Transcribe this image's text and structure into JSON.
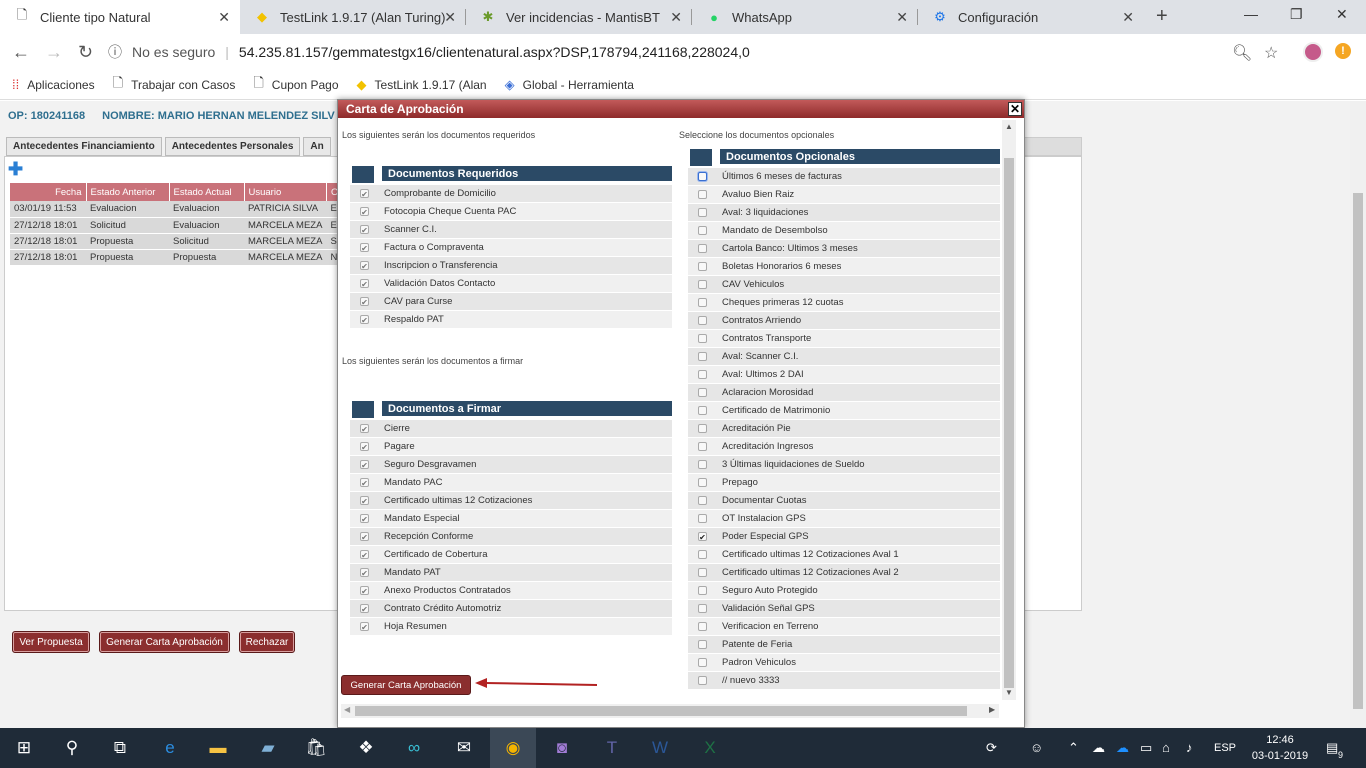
{
  "browser": {
    "tabs": [
      {
        "title": "Cliente tipo Natural",
        "icon": "page-icon"
      },
      {
        "title": "TestLink 1.9.17 (Alan Turing)",
        "icon": "testlink-icon"
      },
      {
        "title": "Ver incidencias - MantisBT",
        "icon": "mantis-icon"
      },
      {
        "title": "WhatsApp",
        "icon": "whatsapp-icon"
      },
      {
        "title": "Configuración",
        "icon": "gear-icon"
      }
    ],
    "security_label": "No es seguro",
    "url": "54.235.81.157/gemmatestgx16/clientenatural.aspx?DSP,178794,241168,228024,0",
    "bookmarks": [
      "Aplicaciones",
      "Trabajar con Casos",
      "Cupon Pago",
      "TestLink 1.9.17 (Alan",
      "Global - Herramienta"
    ]
  },
  "page": {
    "op_label": "OP: 180241168",
    "name_label": "NOMBRE: MARIO HERNAN MELENDEZ SILV",
    "tabs": [
      "Antecedentes Financiamiento",
      "Antecedentes Personales",
      "An"
    ],
    "history_headers": [
      "Fecha",
      "Estado Anterior",
      "Estado Actual",
      "Usuario",
      "O"
    ],
    "history_rows": [
      [
        "03/01/19 11:53",
        "Evaluacion",
        "Evaluacion",
        "PATRICIA SILVA",
        "Ev"
      ],
      [
        "27/12/18 18:01",
        "Solicitud",
        "Evaluacion",
        "MARCELA MEZA",
        "Ev"
      ],
      [
        "27/12/18 18:01",
        "Propuesta",
        "Solicitud",
        "MARCELA MEZA",
        "So"
      ],
      [
        "27/12/18 18:01",
        "Propuesta",
        "Propuesta",
        "MARCELA MEZA",
        "No"
      ]
    ],
    "buttons": {
      "ver_propuesta": "Ver Propuesta",
      "generar_carta": "Generar Carta Aprobación",
      "rechazar": "Rechazar"
    }
  },
  "modal": {
    "title": "Carta de Aprobación",
    "close": "✕",
    "note_required": "Los siguientes serán los documentos requeridos",
    "note_optional": "Seleccione los documentos opcionales",
    "note_sign": "Los siguientes serán los documentos a firmar",
    "required_header": "Documentos Requeridos",
    "required_docs": [
      "Comprobante de Domicilio",
      "Fotocopia Cheque Cuenta PAC",
      "Scanner C.I.",
      "Factura o Compraventa",
      "Inscripcion o Transferencia",
      "Validación Datos Contacto",
      "CAV para Curse",
      "Respaldo PAT"
    ],
    "sign_header": "Documentos a Firmar",
    "sign_docs": [
      "Cierre",
      "Pagare",
      "Seguro Desgravamen",
      "Mandato PAC",
      "Certificado ultimas 12 Cotizaciones",
      "Mandato Especial",
      "Recepción Conforme",
      "Certificado de Cobertura",
      "Mandato PAT",
      "Anexo Productos Contratados",
      "Contrato Crédito Automotriz",
      "Hoja Resumen"
    ],
    "optional_header": "Documentos Opcionales",
    "optional_docs": [
      "Últimos 6 meses de facturas",
      "Avaluo Bien Raiz",
      "Aval: 3 liquidaciones",
      "Mandato de Desembolso",
      "Cartola Banco: Ultimos 3 meses",
      "Boletas Honorarios 6 meses",
      "CAV Vehiculos",
      "Cheques primeras 12 cuotas",
      "Contratos Arriendo",
      "Contratos Transporte",
      "Aval: Scanner C.I.",
      "Aval: Ultimos 2 DAI",
      "Aclaracion Morosidad",
      "Certificado de Matrimonio",
      "Acreditación Pie",
      "Acreditación Ingresos",
      "3 Últimas liquidaciones de Sueldo",
      "Prepago",
      "Documentar Cuotas",
      "OT Instalacion GPS",
      "Poder Especial GPS",
      "Certificado ultimas 12 Cotizaciones Aval 1",
      "Certificado ultimas 12 Cotizaciones Aval 2",
      "Seguro Auto Protegido",
      "Validación Señal GPS",
      "Verificacion en Terreno",
      "Patente de Feria",
      "Padron Vehiculos",
      "// nuevo 3333"
    ],
    "optional_checked_index": 20,
    "generate_button": "Generar Carta Aprobación"
  },
  "taskbar": {
    "lang": "ESP",
    "time": "12:46",
    "date": "03-01-2019",
    "notifications": "9"
  }
}
